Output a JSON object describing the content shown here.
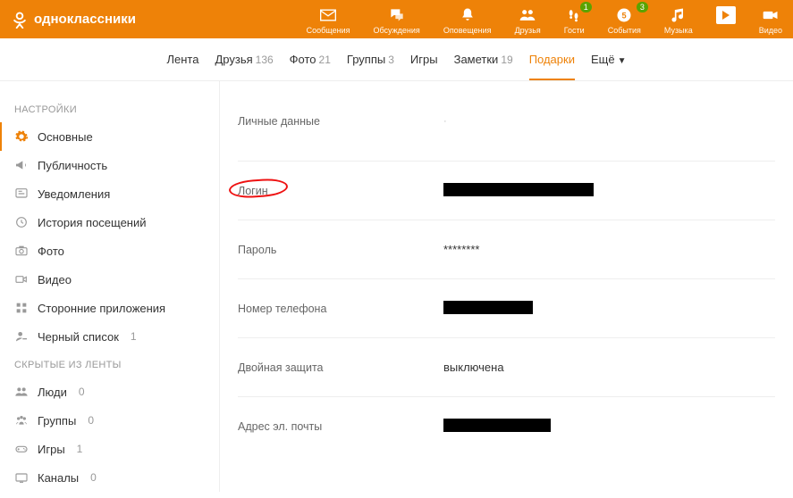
{
  "brand": "одноклассники",
  "header_nav": {
    "messages": "Сообщения",
    "discussions": "Обсуждения",
    "notifications": "Оповещения",
    "friends": "Друзья",
    "guests": "Гости",
    "events": "События",
    "music": "Музыка",
    "video": "Видео",
    "guests_badge": "1",
    "events_badge": "3"
  },
  "tabs": {
    "feed": "Лента",
    "friends": "Друзья",
    "friends_cnt": "136",
    "photo": "Фото",
    "photo_cnt": "21",
    "groups": "Группы",
    "groups_cnt": "3",
    "games": "Игры",
    "notes": "Заметки",
    "notes_cnt": "19",
    "gifts": "Подарки",
    "more": "Ещё"
  },
  "sidebar": {
    "settings_title": "НАСТРОЙКИ",
    "main": "Основные",
    "publicity": "Публичность",
    "notify": "Уведомления",
    "history": "История посещений",
    "photo": "Фото",
    "video": "Видео",
    "apps": "Сторонние приложения",
    "blacklist": "Черный список",
    "blacklist_cnt": "1",
    "hidden_title": "СКРЫТЫЕ ИЗ ЛЕНТЫ",
    "people": "Люди",
    "people_cnt": "0",
    "groups": "Группы",
    "groups_cnt": "0",
    "games": "Игры",
    "games_cnt": "1",
    "channels": "Каналы",
    "channels_cnt": "0"
  },
  "settings": {
    "personal": "Личные данные",
    "personal_value": "·",
    "login": "Логин",
    "password": "Пароль",
    "password_value": "********",
    "phone": "Номер телефона",
    "twofa": "Двойная защита",
    "twofa_value": "выключена",
    "email": "Адрес эл. почты"
  }
}
